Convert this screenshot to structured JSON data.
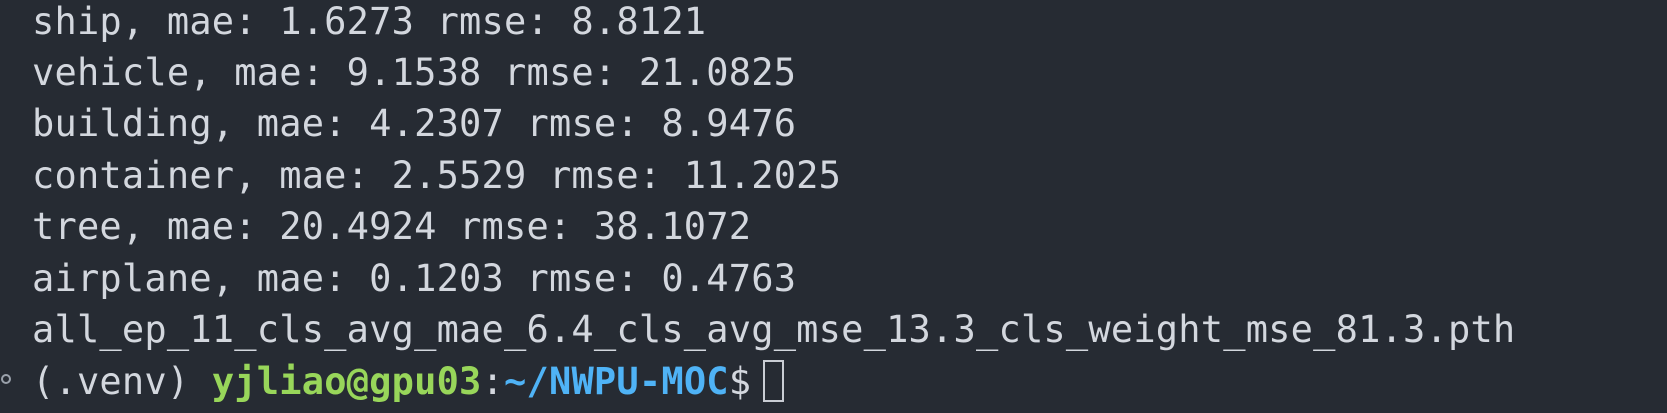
{
  "terminal": {
    "output_lines": [
      "ship, mae: 1.6273 rmse: 8.8121",
      "vehicle, mae: 9.1538 rmse: 21.0825",
      "building, mae: 4.2307 rmse: 8.9476",
      "container, mae: 2.5529 rmse: 11.2025",
      "tree, mae: 20.4924 rmse: 38.1072",
      "airplane, mae: 0.1203 rmse: 0.4763",
      "all_ep_11_cls_avg_mae_6.4_cls_avg_mse_13.3_cls_weight_mse_81.3.pth"
    ],
    "prompt": {
      "venv": "(.venv) ",
      "user_host": "yjliao@gpu03",
      "separator": ":",
      "path": "~/NWPU-MOC",
      "symbol": "$"
    },
    "colors": {
      "background": "#262b33",
      "text": "#d3d7de",
      "user_host": "#98d65a",
      "path": "#4fb3f6"
    }
  }
}
